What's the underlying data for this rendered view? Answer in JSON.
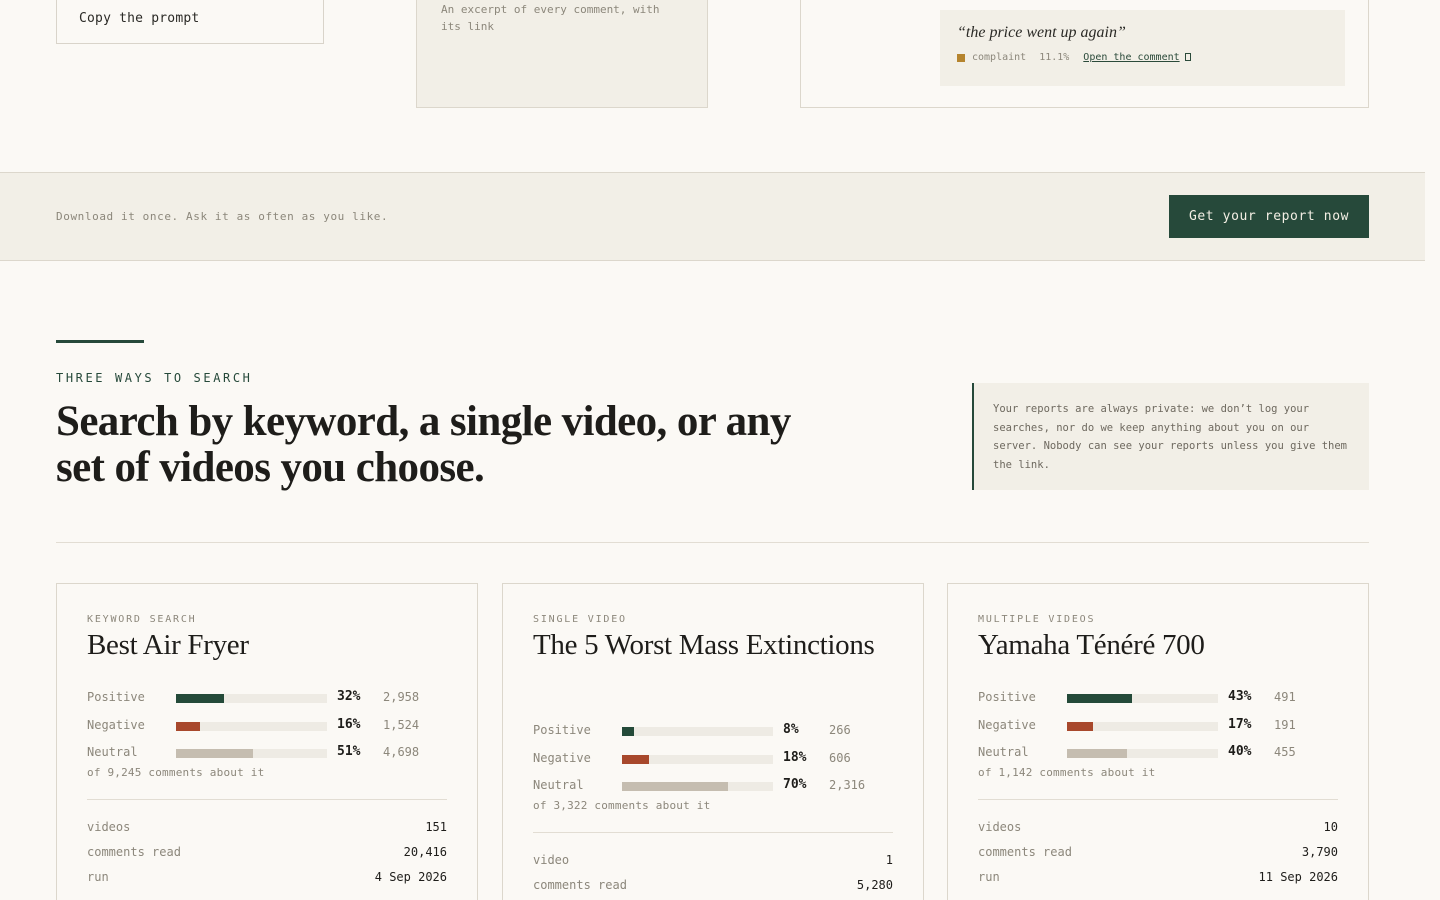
{
  "top": {
    "copy_button": "Copy the prompt",
    "excerpt_text": "An excerpt of every comment, with its link",
    "quote": {
      "text": "“the price went up again”",
      "tag": "complaint",
      "percent": "11.1%",
      "link_label": "Open the comment",
      "tag_color": "#b5842e"
    }
  },
  "banner": {
    "text": "Download it once. Ask it as often as you like.",
    "cta_label": "Get your report now"
  },
  "section": {
    "eyebrow": "THREE WAYS TO SEARCH",
    "headline": "Search by keyword, a single video, or any set of videos you choose.",
    "privacy_note": "Your reports are always private: we don’t log your searches, nor do we keep anything about you on our server. Nobody can see your reports unless you give them the link."
  },
  "colors": {
    "positive": "#244a39",
    "negative": "#a8482c",
    "neutral": "#c5bdb0",
    "accent": "#26493a"
  },
  "cards": [
    {
      "type": "KEYWORD SEARCH",
      "title": "Best Air Fryer",
      "sentiment": [
        {
          "label": "Positive",
          "percent": "32%",
          "fraction": 0.32,
          "count": "2,958"
        },
        {
          "label": "Negative",
          "percent": "16%",
          "fraction": 0.16,
          "count": "1,524"
        },
        {
          "label": "Neutral",
          "percent": "51%",
          "fraction": 0.51,
          "count": "4,698"
        }
      ],
      "of_line": "of 9,245 comments about it",
      "stats": [
        {
          "key": "videos",
          "value": "151"
        },
        {
          "key": "comments read",
          "value": "20,416"
        },
        {
          "key": "run",
          "value": "4 Sep 2026"
        }
      ]
    },
    {
      "type": "SINGLE VIDEO",
      "title": "The 5 Worst Mass Extinctions",
      "sentiment": [
        {
          "label": "Positive",
          "percent": "8%",
          "fraction": 0.08,
          "count": "266"
        },
        {
          "label": "Negative",
          "percent": "18%",
          "fraction": 0.18,
          "count": "606"
        },
        {
          "label": "Neutral",
          "percent": "70%",
          "fraction": 0.7,
          "count": "2,316"
        }
      ],
      "of_line": "of 3,322 comments about it",
      "stats": [
        {
          "key": "video",
          "value": "1"
        },
        {
          "key": "comments read",
          "value": "5,280"
        }
      ]
    },
    {
      "type": "MULTIPLE VIDEOS",
      "title": "Yamaha Ténéré 700",
      "sentiment": [
        {
          "label": "Positive",
          "percent": "43%",
          "fraction": 0.43,
          "count": "491"
        },
        {
          "label": "Negative",
          "percent": "17%",
          "fraction": 0.17,
          "count": "191"
        },
        {
          "label": "Neutral",
          "percent": "40%",
          "fraction": 0.4,
          "count": "455"
        }
      ],
      "of_line": "of 1,142 comments about it",
      "stats": [
        {
          "key": "videos",
          "value": "10"
        },
        {
          "key": "comments read",
          "value": "3,790"
        },
        {
          "key": "run",
          "value": "11 Sep 2026"
        }
      ]
    }
  ]
}
